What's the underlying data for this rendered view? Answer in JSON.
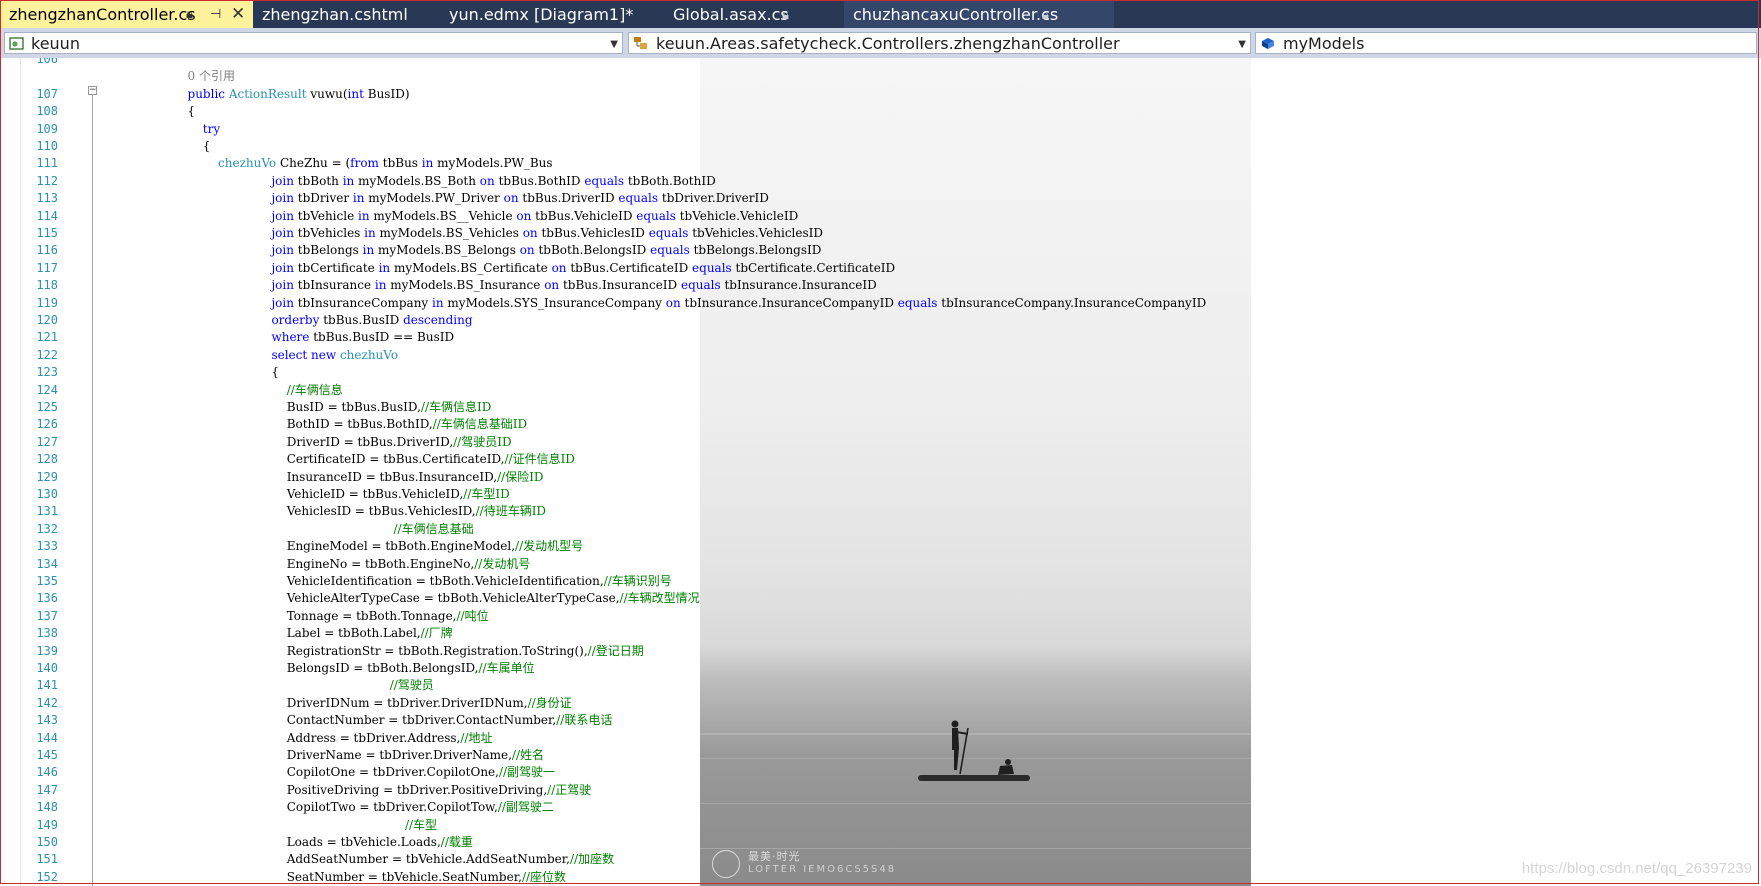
{
  "tabs": [
    {
      "label": "zhengzhanController.cs",
      "active": true
    },
    {
      "label": "zhengzhan.cshtml",
      "active": false
    },
    {
      "label": "yun.edmx [Diagram1]*",
      "active": false
    },
    {
      "label": "Global.asax.cs",
      "active": false
    },
    {
      "label": "chuzhancaxuController.cs",
      "active": false
    }
  ],
  "nav": {
    "project": "keuun",
    "class": "keuun.Areas.safetycheck.Controllers.zhengzhanController",
    "member": "myModels"
  },
  "photo_watermark": {
    "line1": "最美·时光",
    "line2": "LOFTER IEMO6CS5S48"
  },
  "page_watermark": "https://blog.csdn.net/qq_26397239",
  "colors": {
    "keyword": "#0000ff",
    "type": "#2b91af",
    "comment": "#008000",
    "line_number": "#2b91af",
    "tab_strip": "#293955",
    "active_tab": "#fff29d"
  },
  "code_lines": [
    {
      "n": "106",
      "segs": []
    },
    {
      "n": "",
      "segs": [
        {
          "t": "        "
        },
        {
          "t": "0 个引用",
          "c": "gray"
        }
      ]
    },
    {
      "n": "107",
      "segs": [
        {
          "t": "        "
        },
        {
          "t": "public",
          "c": "kw"
        },
        {
          "t": " "
        },
        {
          "t": "ActionResult",
          "c": "ty"
        },
        {
          "t": " vuwu("
        },
        {
          "t": "int",
          "c": "kw"
        },
        {
          "t": " BusID)"
        }
      ]
    },
    {
      "n": "108",
      "segs": [
        {
          "t": "        {"
        }
      ]
    },
    {
      "n": "109",
      "segs": [
        {
          "t": "            "
        },
        {
          "t": "try",
          "c": "kw"
        }
      ]
    },
    {
      "n": "110",
      "segs": [
        {
          "t": "            {"
        }
      ]
    },
    {
      "n": "111",
      "segs": [
        {
          "t": "                "
        },
        {
          "t": "chezhuVo",
          "c": "ty"
        },
        {
          "t": " CheZhu = ("
        },
        {
          "t": "from",
          "c": "kw"
        },
        {
          "t": " tbBus "
        },
        {
          "t": "in",
          "c": "kw"
        },
        {
          "t": " myModels.PW_Bus"
        }
      ]
    },
    {
      "n": "112",
      "segs": [
        {
          "t": "                              "
        },
        {
          "t": "join",
          "c": "kw"
        },
        {
          "t": " tbBoth "
        },
        {
          "t": "in",
          "c": "kw"
        },
        {
          "t": " myModels.BS_Both "
        },
        {
          "t": "on",
          "c": "kw"
        },
        {
          "t": " tbBus.BothID "
        },
        {
          "t": "equals",
          "c": "kw"
        },
        {
          "t": " tbBoth.BothID"
        }
      ]
    },
    {
      "n": "113",
      "segs": [
        {
          "t": "                              "
        },
        {
          "t": "join",
          "c": "kw"
        },
        {
          "t": " tbDriver "
        },
        {
          "t": "in",
          "c": "kw"
        },
        {
          "t": " myModels.PW_Driver "
        },
        {
          "t": "on",
          "c": "kw"
        },
        {
          "t": " tbBus.DriverID "
        },
        {
          "t": "equals",
          "c": "kw"
        },
        {
          "t": " tbDriver.DriverID"
        }
      ]
    },
    {
      "n": "114",
      "segs": [
        {
          "t": "                              "
        },
        {
          "t": "join",
          "c": "kw"
        },
        {
          "t": " tbVehicle "
        },
        {
          "t": "in",
          "c": "kw"
        },
        {
          "t": " myModels.BS__Vehicle "
        },
        {
          "t": "on",
          "c": "kw"
        },
        {
          "t": " tbBus.VehicleID "
        },
        {
          "t": "equals",
          "c": "kw"
        },
        {
          "t": " tbVehicle.VehicleID"
        }
      ]
    },
    {
      "n": "115",
      "segs": [
        {
          "t": "                              "
        },
        {
          "t": "join",
          "c": "kw"
        },
        {
          "t": " tbVehicles "
        },
        {
          "t": "in",
          "c": "kw"
        },
        {
          "t": " myModels.BS_Vehicles "
        },
        {
          "t": "on",
          "c": "kw"
        },
        {
          "t": " tbBus.VehiclesID "
        },
        {
          "t": "equals",
          "c": "kw"
        },
        {
          "t": " tbVehicles.VehiclesID"
        }
      ]
    },
    {
      "n": "116",
      "segs": [
        {
          "t": "                              "
        },
        {
          "t": "join",
          "c": "kw"
        },
        {
          "t": " tbBelongs "
        },
        {
          "t": "in",
          "c": "kw"
        },
        {
          "t": " myModels.BS_Belongs "
        },
        {
          "t": "on",
          "c": "kw"
        },
        {
          "t": " tbBoth.BelongsID "
        },
        {
          "t": "equals",
          "c": "kw"
        },
        {
          "t": " tbBelongs.BelongsID"
        }
      ]
    },
    {
      "n": "117",
      "segs": [
        {
          "t": "                              "
        },
        {
          "t": "join",
          "c": "kw"
        },
        {
          "t": " tbCertificate "
        },
        {
          "t": "in",
          "c": "kw"
        },
        {
          "t": " myModels.BS_Certificate "
        },
        {
          "t": "on",
          "c": "kw"
        },
        {
          "t": " tbBus.CertificateID "
        },
        {
          "t": "equals",
          "c": "kw"
        },
        {
          "t": " tbCertificate.CertificateID"
        }
      ]
    },
    {
      "n": "118",
      "segs": [
        {
          "t": "                              "
        },
        {
          "t": "join",
          "c": "kw"
        },
        {
          "t": " tbInsurance "
        },
        {
          "t": "in",
          "c": "kw"
        },
        {
          "t": " myModels.BS_Insurance "
        },
        {
          "t": "on",
          "c": "kw"
        },
        {
          "t": " tbBus.InsuranceID "
        },
        {
          "t": "equals",
          "c": "kw"
        },
        {
          "t": " tbInsurance.InsuranceID"
        }
      ]
    },
    {
      "n": "119",
      "segs": [
        {
          "t": "                              "
        },
        {
          "t": "join",
          "c": "kw"
        },
        {
          "t": " tbInsuranceCompany "
        },
        {
          "t": "in",
          "c": "kw"
        },
        {
          "t": " myModels.SYS_InsuranceCompany "
        },
        {
          "t": "on",
          "c": "kw"
        },
        {
          "t": " tbInsurance.InsuranceCompanyID "
        },
        {
          "t": "equals",
          "c": "kw"
        },
        {
          "t": " tbInsuranceCompany.InsuranceCompanyID"
        }
      ]
    },
    {
      "n": "120",
      "segs": [
        {
          "t": "                              "
        },
        {
          "t": "orderby",
          "c": "kw"
        },
        {
          "t": " tbBus.BusID "
        },
        {
          "t": "descending",
          "c": "kw"
        }
      ]
    },
    {
      "n": "121",
      "segs": [
        {
          "t": "                              "
        },
        {
          "t": "where",
          "c": "kw"
        },
        {
          "t": " tbBus.BusID == BusID"
        }
      ]
    },
    {
      "n": "122",
      "segs": [
        {
          "t": "                              "
        },
        {
          "t": "select",
          "c": "kw"
        },
        {
          "t": " "
        },
        {
          "t": "new",
          "c": "kw"
        },
        {
          "t": " "
        },
        {
          "t": "chezhuVo",
          "c": "ty"
        }
      ]
    },
    {
      "n": "123",
      "segs": [
        {
          "t": "                              {"
        }
      ]
    },
    {
      "n": "124",
      "segs": [
        {
          "t": "                                  "
        },
        {
          "t": "//车俩信息",
          "c": "cm"
        }
      ]
    },
    {
      "n": "125",
      "segs": [
        {
          "t": "                                  BusID = tbBus.BusID,"
        },
        {
          "t": "//车俩信息ID",
          "c": "cm"
        }
      ]
    },
    {
      "n": "126",
      "segs": [
        {
          "t": "                                  BothID = tbBus.BothID,"
        },
        {
          "t": "//车俩信息基础ID",
          "c": "cm"
        }
      ]
    },
    {
      "n": "127",
      "segs": [
        {
          "t": "                                  DriverID = tbBus.DriverID,"
        },
        {
          "t": "//驾驶员ID",
          "c": "cm"
        }
      ]
    },
    {
      "n": "128",
      "segs": [
        {
          "t": "                                  CertificateID = tbBus.CertificateID,"
        },
        {
          "t": "//证件信息ID",
          "c": "cm"
        }
      ]
    },
    {
      "n": "129",
      "segs": [
        {
          "t": "                                  InsuranceID = tbBus.InsuranceID,"
        },
        {
          "t": "//保险ID",
          "c": "cm"
        }
      ]
    },
    {
      "n": "130",
      "segs": [
        {
          "t": "                                  VehicleID = tbBus.VehicleID,"
        },
        {
          "t": "//车型ID",
          "c": "cm"
        }
      ]
    },
    {
      "n": "131",
      "segs": [
        {
          "t": "                                  VehiclesID = tbBus.VehiclesID,"
        },
        {
          "t": "//待班车辆ID",
          "c": "cm"
        }
      ]
    },
    {
      "n": "132",
      "segs": [
        {
          "t": "                                                              "
        },
        {
          "t": "//车俩信息基础",
          "c": "cm"
        }
      ]
    },
    {
      "n": "133",
      "segs": [
        {
          "t": "                                  EngineModel = tbBoth.EngineModel,"
        },
        {
          "t": "//发动机型号",
          "c": "cm"
        }
      ]
    },
    {
      "n": "134",
      "segs": [
        {
          "t": "                                  EngineNo = tbBoth.EngineNo,"
        },
        {
          "t": "//发动机号",
          "c": "cm"
        }
      ]
    },
    {
      "n": "135",
      "segs": [
        {
          "t": "                                  VehicleIdentification = tbBoth.VehicleIdentification,"
        },
        {
          "t": "//车辆识别号",
          "c": "cm"
        }
      ]
    },
    {
      "n": "136",
      "segs": [
        {
          "t": "                                  VehicleAlterTypeCase = tbBoth.VehicleAlterTypeCase,"
        },
        {
          "t": "//车辆改型情况",
          "c": "cm"
        }
      ]
    },
    {
      "n": "137",
      "segs": [
        {
          "t": "                                  Tonnage = tbBoth.Tonnage,"
        },
        {
          "t": "//吨位",
          "c": "cm"
        }
      ]
    },
    {
      "n": "138",
      "segs": [
        {
          "t": "                                  Label = tbBoth.Label,"
        },
        {
          "t": "//厂牌",
          "c": "cm"
        }
      ]
    },
    {
      "n": "139",
      "segs": [
        {
          "t": "                                  RegistrationStr = tbBoth.Registration.ToString(),"
        },
        {
          "t": "//登记日期",
          "c": "cm"
        }
      ]
    },
    {
      "n": "140",
      "segs": [
        {
          "t": "                                  BelongsID = tbBoth.BelongsID,"
        },
        {
          "t": "//车属单位",
          "c": "cm"
        }
      ]
    },
    {
      "n": "141",
      "segs": [
        {
          "t": "                                                             "
        },
        {
          "t": "//驾驶员",
          "c": "cm"
        }
      ]
    },
    {
      "n": "142",
      "segs": [
        {
          "t": "                                  DriverIDNum = tbDriver.DriverIDNum,"
        },
        {
          "t": "//身份证",
          "c": "cm"
        }
      ]
    },
    {
      "n": "143",
      "segs": [
        {
          "t": "                                  ContactNumber = tbDriver.ContactNumber,"
        },
        {
          "t": "//联系电话",
          "c": "cm"
        }
      ]
    },
    {
      "n": "144",
      "segs": [
        {
          "t": "                                  Address = tbDriver.Address,"
        },
        {
          "t": "//地址",
          "c": "cm"
        }
      ]
    },
    {
      "n": "145",
      "segs": [
        {
          "t": "                                  DriverName = tbDriver.DriverName,"
        },
        {
          "t": "//姓名",
          "c": "cm"
        }
      ]
    },
    {
      "n": "146",
      "segs": [
        {
          "t": "                                  CopilotOne = tbDriver.CopilotOne,"
        },
        {
          "t": "//副驾驶一",
          "c": "cm"
        }
      ]
    },
    {
      "n": "147",
      "segs": [
        {
          "t": "                                  PositiveDriving = tbDriver.PositiveDriving,"
        },
        {
          "t": "//正驾驶",
          "c": "cm"
        }
      ]
    },
    {
      "n": "148",
      "segs": [
        {
          "t": "                                  CopilotTwo = tbDriver.CopilotTow,"
        },
        {
          "t": "//副驾驶二",
          "c": "cm"
        }
      ]
    },
    {
      "n": "149",
      "segs": [
        {
          "t": "                                                                 "
        },
        {
          "t": "//车型",
          "c": "cm"
        }
      ]
    },
    {
      "n": "150",
      "segs": [
        {
          "t": "                                  Loads = tbVehicle.Loads,"
        },
        {
          "t": "//载重",
          "c": "cm"
        }
      ]
    },
    {
      "n": "151",
      "segs": [
        {
          "t": "                                  AddSeatNumber = tbVehicle.AddSeatNumber,"
        },
        {
          "t": "//加座数",
          "c": "cm"
        }
      ]
    },
    {
      "n": "152",
      "segs": [
        {
          "t": "                                  SeatNumber = tbVehicle.SeatNumber,"
        },
        {
          "t": "//座位数",
          "c": "cm"
        }
      ]
    }
  ]
}
